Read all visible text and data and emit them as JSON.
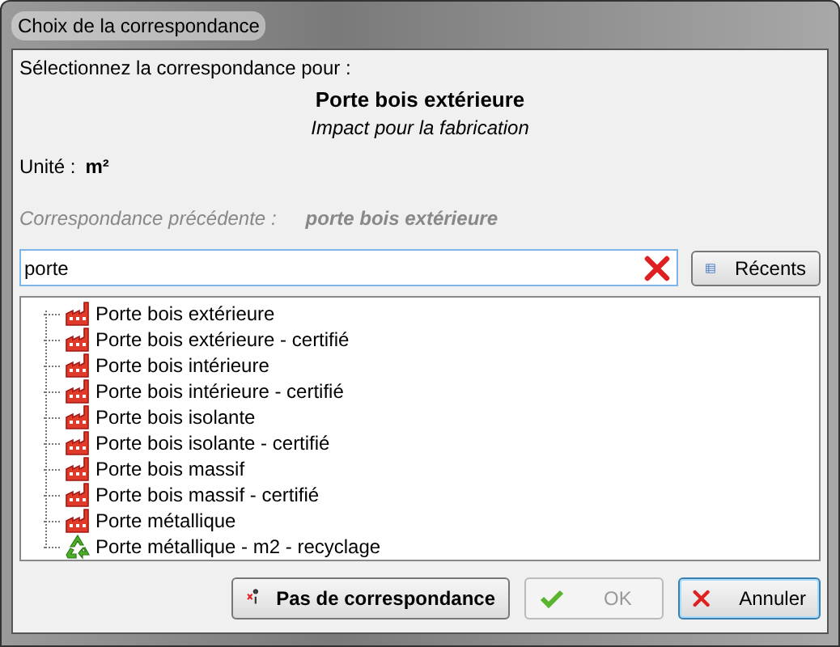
{
  "window": {
    "title": "Choix de la correspondance"
  },
  "header": {
    "prompt": "Sélectionnez la correspondance pour :",
    "product": "Porte bois extérieure",
    "subtitle": "Impact pour la fabrication",
    "unit_label": "Unité :",
    "unit_value": "m²",
    "previous_label": "Correspondance précédente :",
    "previous_value": "porte bois extérieure"
  },
  "search": {
    "value": "porte"
  },
  "recent_button": {
    "label": "Récents"
  },
  "tree": {
    "items": [
      {
        "label": "Porte bois extérieure",
        "kind": "factory"
      },
      {
        "label": "Porte bois extérieure - certifié",
        "kind": "factory"
      },
      {
        "label": "Porte bois intérieure",
        "kind": "factory"
      },
      {
        "label": "Porte bois intérieure - certifié",
        "kind": "factory"
      },
      {
        "label": "Porte bois isolante",
        "kind": "factory"
      },
      {
        "label": "Porte bois isolante - certifié",
        "kind": "factory"
      },
      {
        "label": "Porte bois massif",
        "kind": "factory"
      },
      {
        "label": "Porte bois massif - certifié",
        "kind": "factory"
      },
      {
        "label": "Porte métallique",
        "kind": "factory"
      },
      {
        "label": "Porte métallique - m2 - recyclage",
        "kind": "recycle"
      }
    ]
  },
  "buttons": [
    {
      "label": "Pas de correspondance",
      "kind": "none",
      "disabled": false,
      "focused": false
    },
    {
      "label": "OK",
      "kind": "ok",
      "disabled": true,
      "focused": false
    },
    {
      "label": "Annuler",
      "kind": "cancel",
      "disabled": false,
      "focused": true
    }
  ]
}
